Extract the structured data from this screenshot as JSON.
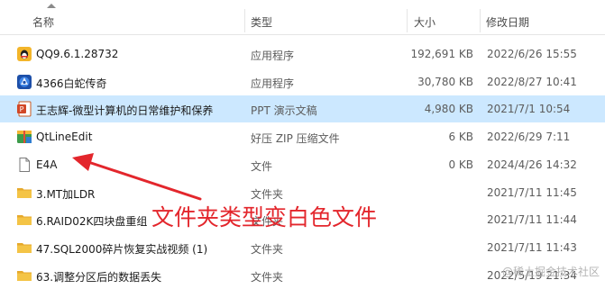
{
  "columns": {
    "name": "名称",
    "type": "类型",
    "size": "大小",
    "date": "修改日期"
  },
  "files": [
    {
      "name": "QQ9.6.1.28732",
      "type": "应用程序",
      "size": "192,691 KB",
      "date": "2022/6/26 15:55",
      "icon": "qq-app-icon"
    },
    {
      "name": "4366白蛇传奇",
      "type": "应用程序",
      "size": "30,780 KB",
      "date": "2022/8/27 10:41",
      "icon": "game-app-icon"
    },
    {
      "name": "王志辉-微型计算机的日常维护和保养",
      "type": "PPT 演示文稿",
      "size": "4,980 KB",
      "date": "2021/7/1 10:54",
      "icon": "ppt-file-icon"
    },
    {
      "name": "QtLineEdit",
      "type": "好压 ZIP 压缩文件",
      "size": "6 KB",
      "date": "2022/6/29 7:11",
      "icon": "zip-archive-icon"
    },
    {
      "name": "E4A",
      "type": "文件",
      "size": "0 KB",
      "date": "2024/4/26 14:32",
      "icon": "blank-file-icon"
    },
    {
      "name": "3.MT加LDR",
      "type": "文件夹",
      "size": "",
      "date": "2021/7/11 11:45",
      "icon": "folder-icon"
    },
    {
      "name": "6.RAID02K四块盘重组",
      "type": "文件夹",
      "size": "",
      "date": "2021/7/11 11:44",
      "icon": "folder-icon"
    },
    {
      "name": "47.SQL2000碎片恢复实战视频 (1)",
      "type": "文件夹",
      "size": "",
      "date": "2021/7/11 11:43",
      "icon": "folder-icon"
    },
    {
      "name": "63.调整分区后的数据丢失",
      "type": "文件夹",
      "size": "",
      "date": "2022/5/19 21:34",
      "icon": "folder-icon"
    }
  ],
  "selected_row": 2,
  "annotation": "文件夹类型变白色文件",
  "watermark": "@稀土掘金技术社区",
  "colors": {
    "selection": "#cce8ff",
    "annotation": "#e3262c",
    "folder": "#f4c446"
  }
}
